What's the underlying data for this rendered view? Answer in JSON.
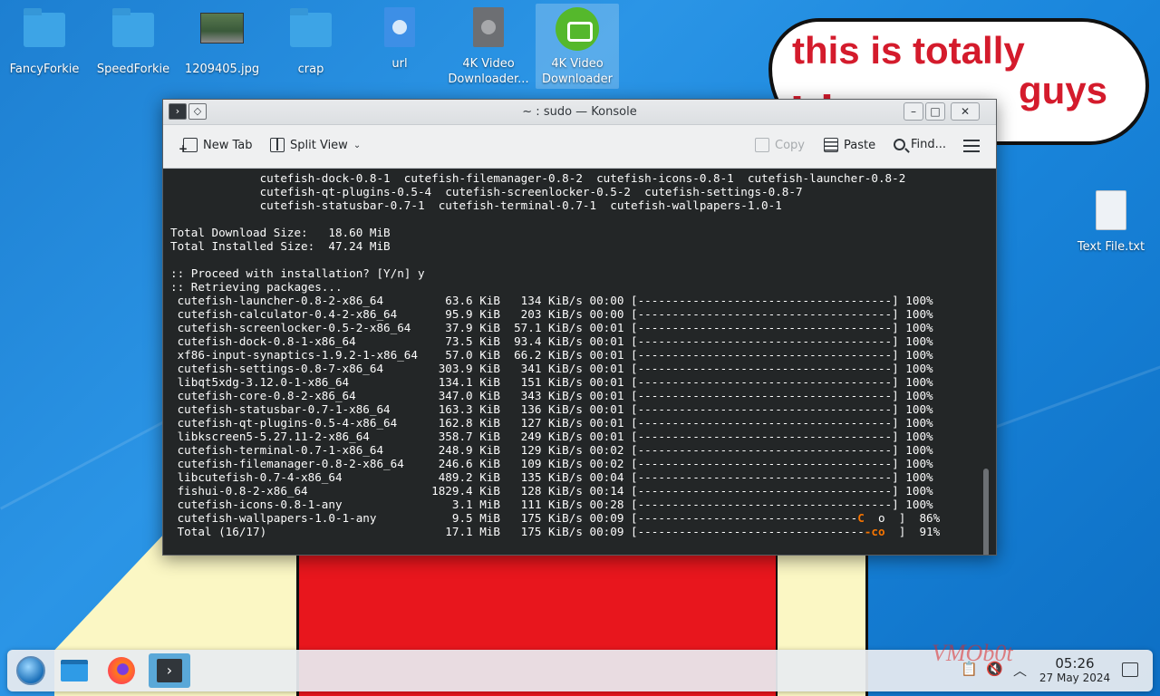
{
  "desktop": {
    "icons": [
      {
        "label": "FancyForkie",
        "icon": "folder-icon"
      },
      {
        "label": "SpeedForkie",
        "icon": "folder-icon"
      },
      {
        "label": "1209405.jpg",
        "icon": "image-icon"
      },
      {
        "label": "crap",
        "icon": "folder-icon"
      },
      {
        "label": "url",
        "icon": "link-file-icon"
      },
      {
        "label": "4K Video Downloader...",
        "icon": "shortcut-file-icon"
      },
      {
        "label": "4K Video Downloader",
        "icon": "4k-video-downloader-icon"
      }
    ],
    "right_icons": [
      {
        "label": "Text File.txt",
        "icon": "text-file-icon"
      }
    ],
    "bubble_text": [
      "this is totally",
      "guys",
      "Linux"
    ],
    "watermark": "VMOb0t"
  },
  "window": {
    "title": "~ : sudo — Konsole",
    "toolbar": {
      "new_tab": "New Tab",
      "split_view": "Split View",
      "copy": "Copy",
      "paste": "Paste",
      "find": "Find..."
    },
    "terminal_lines": [
      "             cutefish-dock-0.8-1  cutefish-filemanager-0.8-2  cutefish-icons-0.8-1  cutefish-launcher-0.8-2",
      "             cutefish-qt-plugins-0.5-4  cutefish-screenlocker-0.5-2  cutefish-settings-0.8-7",
      "             cutefish-statusbar-0.7-1  cutefish-terminal-0.7-1  cutefish-wallpapers-1.0-1",
      "",
      "Total Download Size:   18.60 MiB",
      "Total Installed Size:  47.24 MiB",
      "",
      ":: Proceed with installation? [Y/n] y",
      ":: Retrieving packages...",
      " cutefish-launcher-0.8-2-x86_64         63.6 KiB   134 KiB/s 00:00 [-------------------------------------] 100%",
      " cutefish-calculator-0.4-2-x86_64       95.9 KiB   203 KiB/s 00:00 [-------------------------------------] 100%",
      " cutefish-screenlocker-0.5-2-x86_64     37.9 KiB  57.1 KiB/s 00:01 [-------------------------------------] 100%",
      " cutefish-dock-0.8-1-x86_64             73.5 KiB  93.4 KiB/s 00:01 [-------------------------------------] 100%",
      " xf86-input-synaptics-1.9.2-1-x86_64    57.0 KiB  66.2 KiB/s 00:01 [-------------------------------------] 100%",
      " cutefish-settings-0.8-7-x86_64        303.9 KiB   341 KiB/s 00:01 [-------------------------------------] 100%",
      " libqt5xdg-3.12.0-1-x86_64             134.1 KiB   151 KiB/s 00:01 [-------------------------------------] 100%",
      " cutefish-core-0.8-2-x86_64            347.0 KiB   343 KiB/s 00:01 [-------------------------------------] 100%",
      " cutefish-statusbar-0.7-1-x86_64       163.3 KiB   136 KiB/s 00:01 [-------------------------------------] 100%",
      " cutefish-qt-plugins-0.5-4-x86_64      162.8 KiB   127 KiB/s 00:01 [-------------------------------------] 100%",
      " libkscreen5-5.27.11-2-x86_64          358.7 KiB   249 KiB/s 00:01 [-------------------------------------] 100%",
      " cutefish-terminal-0.7-1-x86_64        248.9 KiB   129 KiB/s 00:02 [-------------------------------------] 100%",
      " cutefish-filemanager-0.8-2-x86_64     246.6 KiB   109 KiB/s 00:02 [-------------------------------------] 100%",
      " libcutefish-0.7-4-x86_64              489.2 KiB   135 KiB/s 00:04 [-------------------------------------] 100%",
      " fishui-0.8-2-x86_64                  1829.4 KiB   128 KiB/s 00:14 [-------------------------------------] 100%",
      " cutefish-icons-0.8-1-any                3.1 MiB   111 KiB/s 00:28 [-------------------------------------] 100%"
    ],
    "progress_lines": [
      {
        "prefix": " cutefish-wallpapers-1.0-1-any           9.5 MiB   175 KiB/s 00:09 [--------------------------------",
        "pac": "C",
        "suffix": "  o  ]  86%"
      },
      {
        "prefix": " Total (16/17)                          17.1 MiB   175 KiB/s 00:09 [---------------------------------",
        "pac": "-co",
        "suffix": "  ]  91%"
      }
    ]
  },
  "taskbar": {
    "clock_time": "05:26",
    "clock_date": "27 May 2024"
  }
}
